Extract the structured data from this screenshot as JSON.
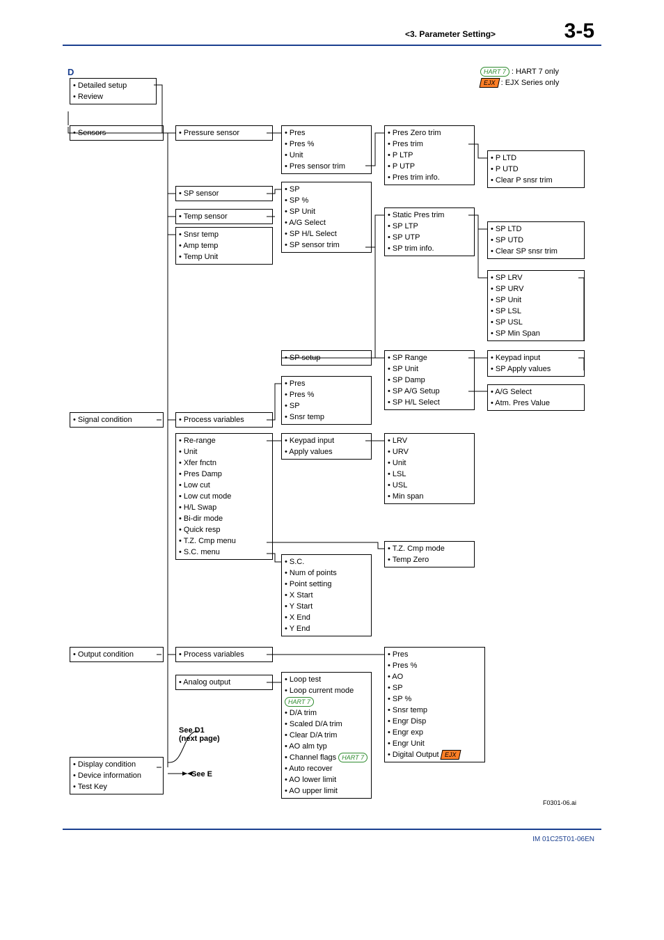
{
  "header": {
    "section": "<3.  Parameter Setting>",
    "pageNum": "3-5"
  },
  "footer": {
    "docId": "IM 01C25T01-06EN",
    "figId": "F0301-06.ai"
  },
  "legend": {
    "hart7": "HART 7",
    "hart7Desc": ": HART 7 only",
    "ejx": "EJX",
    "ejxDesc": ": EJX Series only"
  },
  "labelD": "D",
  "boxD": [
    "• Detailed setup",
    "• Review"
  ],
  "col1a": {
    "items": [
      "• Sensors"
    ]
  },
  "col1b": [
    "• Signal condition"
  ],
  "col1c": [
    "• Output condition"
  ],
  "col1d": [
    "• Display condition",
    "• Device information",
    "• Test Key"
  ],
  "c2_press": [
    "• Pressure sensor"
  ],
  "c2_sp": [
    "• SP sensor"
  ],
  "c2_temp": [
    "• Temp sensor"
  ],
  "c2_snsr": [
    "• Snsr temp",
    "• Amp temp",
    "• Temp Unit"
  ],
  "c2_pv": [
    "• Process variables"
  ],
  "c2_pv_items": [
    "• Re-range",
    "• Unit",
    "• Xfer fnctn",
    "• Pres Damp",
    "• Low cut",
    "• Low cut mode",
    "• H/L Swap",
    "• Bi-dir mode",
    "• Quick resp",
    "• T.Z. Cmp menu",
    "• S.C. menu"
  ],
  "c2_out_pv": [
    "• Process variables"
  ],
  "c2_out_ao": [
    "• Analog output"
  ],
  "seeD1a": "See D1",
  "seeD1b": "(next page)",
  "seeE": "See E",
  "c3_pres": [
    "• Pres",
    "• Pres %",
    "• Unit",
    "• Pres sensor trim"
  ],
  "c3_sp": [
    "• SP",
    "• SP %",
    "• SP Unit",
    "• A/G Select",
    "• SP H/L Select",
    "• SP sensor trim"
  ],
  "c3_spsetup": [
    "• SP setup"
  ],
  "c3_prespv": [
    "• Pres",
    "• Pres %",
    "• SP",
    "• Snsr temp"
  ],
  "c3_keyp": [
    "• Keypad input",
    "• Apply values"
  ],
  "c3_sc": [
    "• S.C.",
    "• Num of points",
    "• Point setting",
    "• X Start",
    "• Y Start",
    "• X End",
    "• Y End"
  ],
  "c3_ao": [
    "• Loop test",
    "• Loop current mode",
    "",
    "• D/A trim",
    "• Scaled D/A trim",
    "• Clear D/A trim",
    "• AO alm typ",
    "• Channel flags",
    "• Auto recover",
    "• AO lower limit",
    "• AO upper limit"
  ],
  "c4_ptrim": [
    "• Pres Zero trim",
    "• Pres trim",
    "• P LTP",
    "• P UTP",
    "• Pres trim info."
  ],
  "c4_sptrim": [
    "• Static Pres trim",
    "• SP LTP",
    "• SP UTP",
    "• SP trim info."
  ],
  "c4_sprange": [
    "• SP Range",
    "• SP Unit",
    "• SP Damp",
    "• SP A/G Setup",
    "• SP H/L Select"
  ],
  "c4_lrv": [
    "• LRV",
    "• URV",
    "• Unit",
    "• LSL",
    "• USL",
    "• Min span"
  ],
  "c4_tz": [
    "• T.Z. Cmp mode",
    "• Temp Zero"
  ],
  "c4_outpv": [
    "• Pres",
    "• Pres %",
    "• AO",
    "• SP",
    "• SP %",
    "• Snsr temp",
    "• Engr Disp",
    "• Engr exp",
    "• Engr Unit",
    "• Digital Output"
  ],
  "c5_p": [
    "• P LTD",
    "• P UTD",
    "• Clear P snsr trim"
  ],
  "c5_sp": [
    "• SP LTD",
    "• SP UTD",
    "• Clear SP snsr trim"
  ],
  "c5_splimits": [
    "• SP LRV",
    "• SP URV",
    "• SP Unit",
    "• SP LSL",
    "• SP USL",
    "• SP Min Span"
  ],
  "c5_keyp": [
    "• Keypad input",
    "• SP Apply values"
  ],
  "c5_ag": [
    "• A/G Select",
    "• Atm. Pres Value"
  ]
}
